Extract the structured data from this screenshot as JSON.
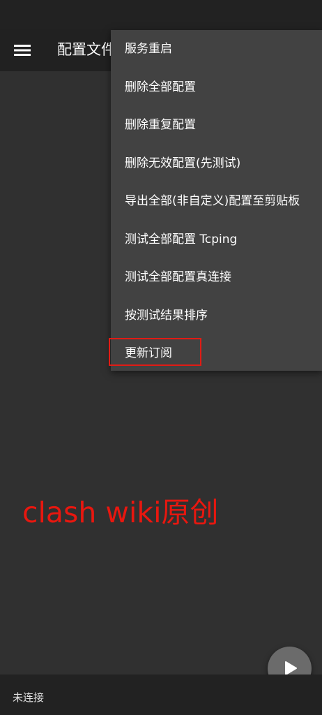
{
  "app_bar": {
    "title": "配置文件",
    "menu_icon": "hamburger-menu-icon"
  },
  "overflow_menu": {
    "items": [
      {
        "label": "服务重启"
      },
      {
        "label": "删除全部配置"
      },
      {
        "label": "删除重复配置"
      },
      {
        "label": "删除无效配置(先测试)"
      },
      {
        "label": "导出全部(非自定义)配置至剪贴板"
      },
      {
        "label": "测试全部配置 Tcping"
      },
      {
        "label": "测试全部配置真连接"
      },
      {
        "label": "按测试结果排序"
      },
      {
        "label": "更新订阅"
      }
    ],
    "highlighted_item": "更新订阅",
    "highlight_color": "#e21b14"
  },
  "watermark": {
    "text": "clash wiki原创",
    "color": "#e8170f"
  },
  "fab": {
    "icon": "play-icon"
  },
  "bottom_bar": {
    "status": "未连接"
  },
  "colors": {
    "background": "#303030",
    "app_bar": "#212121",
    "menu_background": "#424242",
    "fab": "#6b6b6b"
  }
}
